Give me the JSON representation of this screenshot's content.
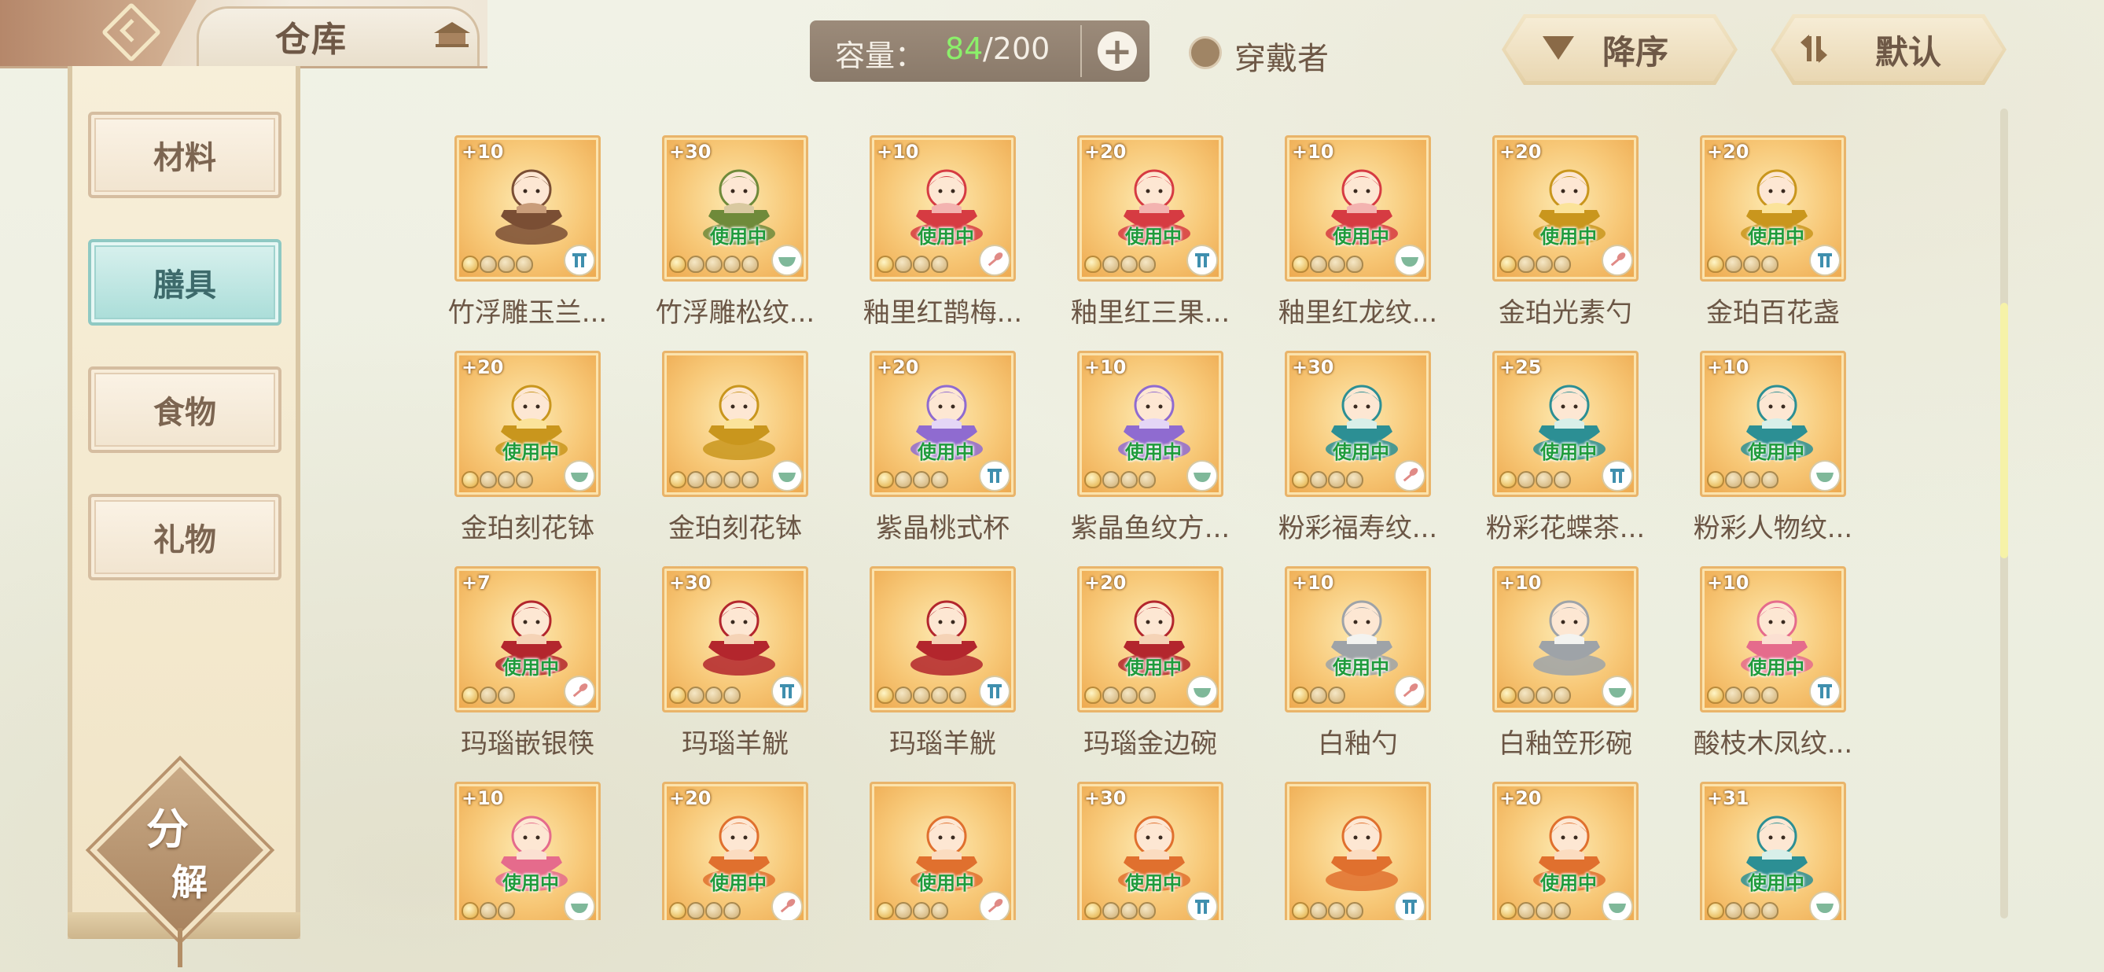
{
  "header": {
    "title": "仓库",
    "capacity_label": "容量：",
    "capacity_current": "84",
    "capacity_max": "/200",
    "wearer_label": "穿戴者",
    "sort_order_label": "降序",
    "sort_mode_label": "默认"
  },
  "sidebar": {
    "items": [
      {
        "label": "材料",
        "active": false
      },
      {
        "label": "膳具",
        "active": true
      },
      {
        "label": "食物",
        "active": false
      },
      {
        "label": "礼物",
        "active": false
      }
    ],
    "decompose_label_1": "分",
    "decompose_label_2": "解"
  },
  "colors": {
    "accent_teal": "#a9ddd8",
    "inuse_green": "#1f9b3c",
    "capacity_green": "#8bf06a"
  },
  "items": [
    {
      "name": "竹浮雕玉兰...",
      "level": "+10",
      "in_use": "",
      "stars": 4,
      "type": "pot",
      "figure": "brown"
    },
    {
      "name": "竹浮雕松纹...",
      "level": "+30",
      "in_use": "使用中",
      "stars": 5,
      "type": "bowl",
      "figure": "green"
    },
    {
      "name": "釉里红鹊梅...",
      "level": "+10",
      "in_use": "使用中",
      "stars": 4,
      "type": "spoon",
      "figure": "red"
    },
    {
      "name": "釉里红三果...",
      "level": "+20",
      "in_use": "使用中",
      "stars": 4,
      "type": "pot",
      "figure": "red"
    },
    {
      "name": "釉里红龙纹...",
      "level": "+10",
      "in_use": "使用中",
      "stars": 4,
      "type": "bowl",
      "figure": "red"
    },
    {
      "name": "金珀光素勺",
      "level": "+20",
      "in_use": "使用中",
      "stars": 4,
      "type": "spoon",
      "figure": "gold"
    },
    {
      "name": "金珀百花盏",
      "level": "+20",
      "in_use": "使用中",
      "stars": 4,
      "type": "pot",
      "figure": "gold"
    },
    {
      "name": "金珀刻花钵",
      "level": "+20",
      "in_use": "使用中",
      "stars": 4,
      "type": "bowl",
      "figure": "gold"
    },
    {
      "name": "金珀刻花钵",
      "level": "",
      "in_use": "",
      "stars": 5,
      "type": "bowl",
      "figure": "gold"
    },
    {
      "name": "紫晶桃式杯",
      "level": "+20",
      "in_use": "使用中",
      "stars": 4,
      "type": "pot",
      "figure": "purple"
    },
    {
      "name": "紫晶鱼纹方...",
      "level": "+10",
      "in_use": "使用中",
      "stars": 4,
      "type": "bowl",
      "figure": "purple"
    },
    {
      "name": "粉彩福寿纹...",
      "level": "+30",
      "in_use": "使用中",
      "stars": 4,
      "type": "spoon",
      "figure": "teal"
    },
    {
      "name": "粉彩花蝶茶...",
      "level": "+25",
      "in_use": "使用中",
      "stars": 4,
      "type": "pot",
      "figure": "teal"
    },
    {
      "name": "粉彩人物纹...",
      "level": "+10",
      "in_use": "使用中",
      "stars": 4,
      "type": "bowl",
      "figure": "teal"
    },
    {
      "name": "玛瑙嵌银筷",
      "level": "+7",
      "in_use": "使用中",
      "stars": 3,
      "type": "spoon",
      "figure": "crimson"
    },
    {
      "name": "玛瑙羊觥",
      "level": "+30",
      "in_use": "",
      "stars": 4,
      "type": "pot",
      "figure": "crimson"
    },
    {
      "name": "玛瑙羊觥",
      "level": "",
      "in_use": "",
      "stars": 5,
      "type": "pot",
      "figure": "crimson"
    },
    {
      "name": "玛瑙金边碗",
      "level": "+20",
      "in_use": "使用中",
      "stars": 4,
      "type": "bowl",
      "figure": "crimson"
    },
    {
      "name": "白釉勺",
      "level": "+10",
      "in_use": "使用中",
      "stars": 3,
      "type": "spoon",
      "figure": "white"
    },
    {
      "name": "白釉笠形碗",
      "level": "+10",
      "in_use": "",
      "stars": 4,
      "type": "bowl",
      "figure": "white"
    },
    {
      "name": "酸枝木凤纹...",
      "level": "+10",
      "in_use": "使用中",
      "stars": 4,
      "type": "pot",
      "figure": "pink"
    },
    {
      "name": "",
      "level": "+10",
      "in_use": "使用中",
      "stars": 3,
      "type": "bowl",
      "figure": "pink"
    },
    {
      "name": "",
      "level": "+20",
      "in_use": "使用中",
      "stars": 4,
      "type": "spoon",
      "figure": "orange"
    },
    {
      "name": "",
      "level": "",
      "in_use": "使用中",
      "stars": 4,
      "type": "spoon",
      "figure": "orange"
    },
    {
      "name": "",
      "level": "+30",
      "in_use": "使用中",
      "stars": 4,
      "type": "pot",
      "figure": "orange"
    },
    {
      "name": "",
      "level": "",
      "in_use": "",
      "stars": 4,
      "type": "pot",
      "figure": "orange"
    },
    {
      "name": "",
      "level": "+20",
      "in_use": "使用中",
      "stars": 4,
      "type": "bowl",
      "figure": "orange"
    },
    {
      "name": "",
      "level": "+31",
      "in_use": "使用中",
      "stars": 4,
      "type": "bowl",
      "figure": "teal"
    }
  ]
}
